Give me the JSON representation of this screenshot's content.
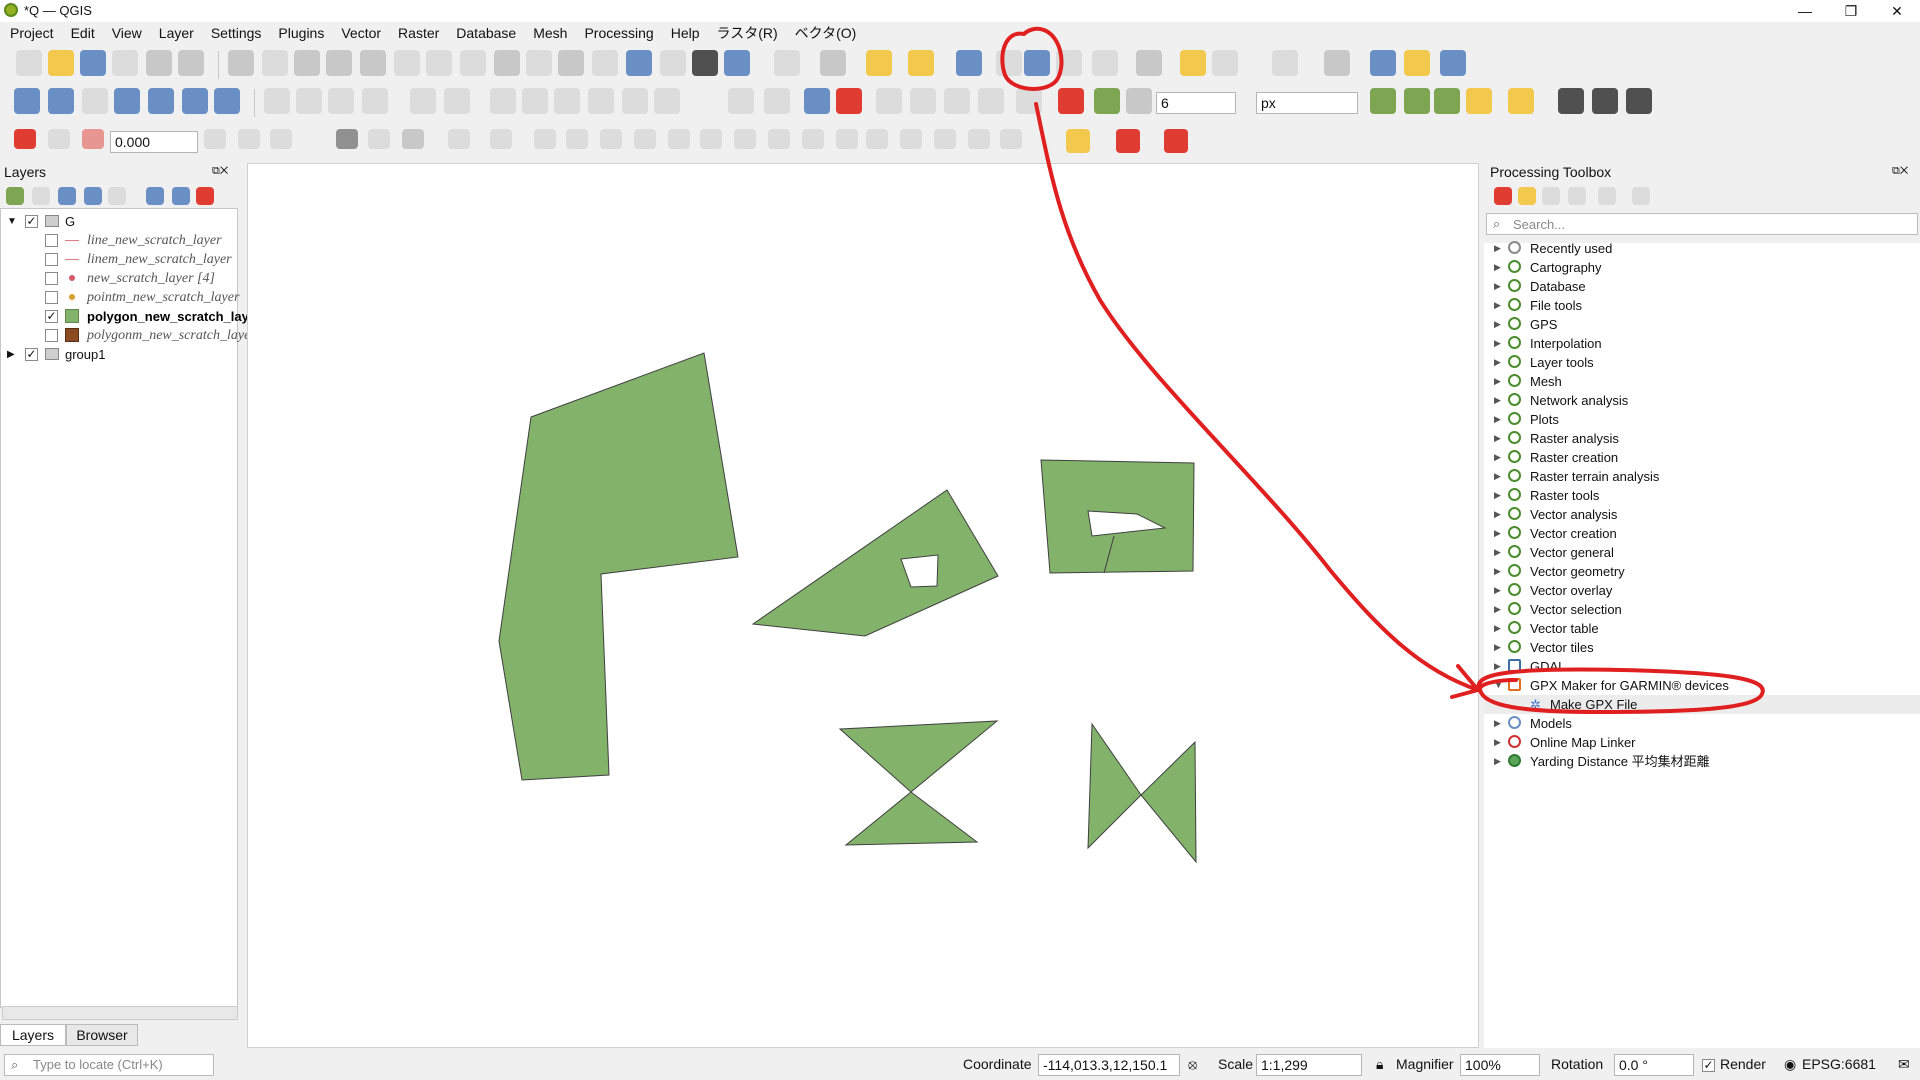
{
  "window": {
    "title": "*Q — QGIS"
  },
  "menu": [
    "Project",
    "Edit",
    "View",
    "Layer",
    "Settings",
    "Plugins",
    "Vector",
    "Raster",
    "Database",
    "Mesh",
    "Processing",
    "Help",
    "ラスタ(R)",
    "ベクタ(O)"
  ],
  "toolbar": {
    "symbol_size": "6",
    "symbol_unit": "px",
    "rotation_value": "0.000"
  },
  "layers_panel": {
    "title": "Layers",
    "group_g": "G",
    "items": [
      {
        "label": "line_new_scratch_layer",
        "checked": false
      },
      {
        "label": "linem_new_scratch_layer",
        "checked": false
      },
      {
        "label": "new_scratch_layer [4]",
        "checked": false
      },
      {
        "label": "pointm_new_scratch_layer",
        "checked": false
      },
      {
        "label": "polygon_new_scratch_layer",
        "checked": true
      },
      {
        "label": "polygonm_new_scratch_layer",
        "checked": false
      }
    ],
    "group1": "group1",
    "tabs": [
      "Layers",
      "Browser"
    ]
  },
  "toolbox": {
    "title": "Processing Toolbox",
    "search_placeholder": "Search...",
    "items": [
      "Recently used",
      "Cartography",
      "Database",
      "File tools",
      "GPS",
      "Interpolation",
      "Layer tools",
      "Mesh",
      "Network analysis",
      "Plots",
      "Raster analysis",
      "Raster creation",
      "Raster terrain analysis",
      "Raster tools",
      "Vector analysis",
      "Vector creation",
      "Vector general",
      "Vector geometry",
      "Vector overlay",
      "Vector selection",
      "Vector table",
      "Vector tiles",
      "GDAL",
      "GPX Maker for GARMIN® devices",
      "Make GPX File",
      "Models",
      "Online Map Linker",
      "Yarding Distance 平均集材距離"
    ]
  },
  "statusbar": {
    "locate_placeholder": "Type to locate (Ctrl+K)",
    "coordinate_label": "Coordinate",
    "coordinate_value": "-114,013.3,12,150.1",
    "scale_label": "Scale",
    "scale_value": "1:1,299",
    "magnifier_label": "Magnifier",
    "magnifier_value": "100%",
    "rotation_label": "Rotation",
    "rotation_value": "0.0 °",
    "render_label": "Render",
    "crs": "EPSG:6681"
  },
  "colors": {
    "polygon_fill": "#83b36b",
    "annotation": "#e02020"
  }
}
